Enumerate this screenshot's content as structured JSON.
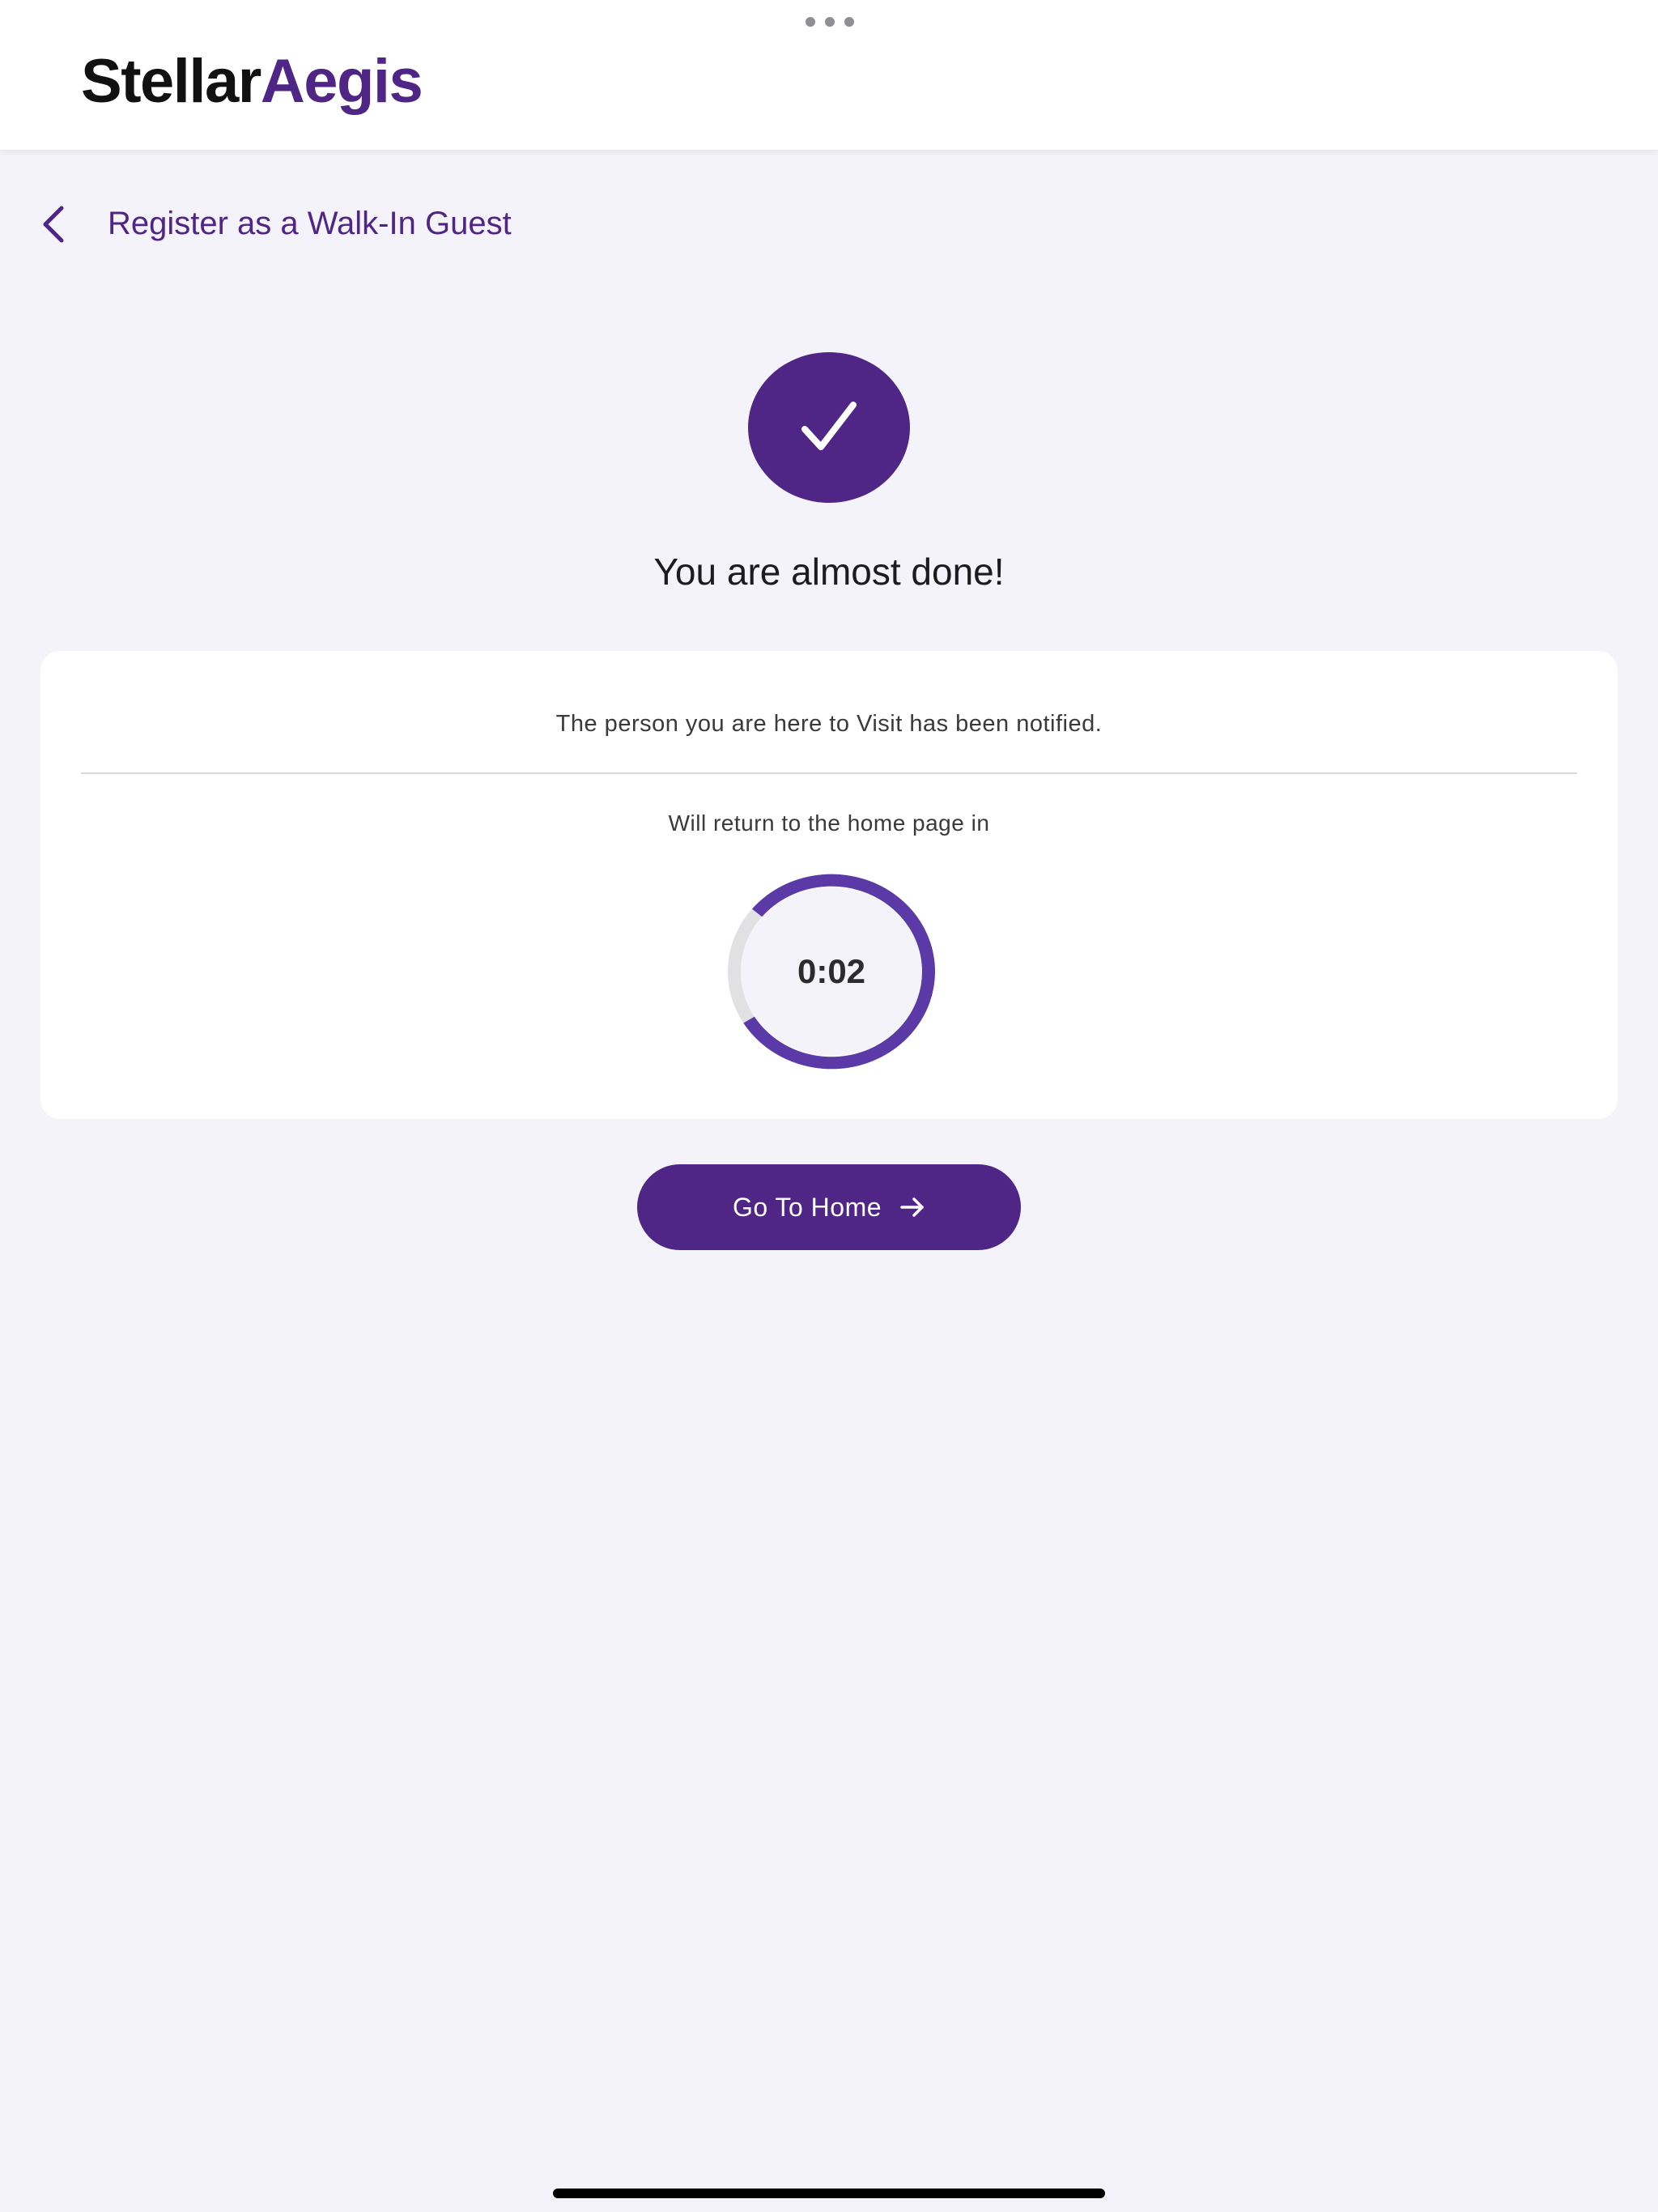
{
  "header": {
    "logo_part1": "Stellar",
    "logo_part2": "Aegis"
  },
  "nav": {
    "back_icon": "chevron-left-icon",
    "title": "Register as a Walk-In Guest"
  },
  "status": {
    "icon": "checkmark-icon",
    "headline": "You are almost done!"
  },
  "card": {
    "message": "The person you are here to Visit has been notified.",
    "return_text": "Will return to the home page in",
    "timer": {
      "value": "0:02",
      "progress_fraction": 0.8
    }
  },
  "actions": {
    "home_label": "Go To Home",
    "home_icon": "arrow-right-icon"
  },
  "colors": {
    "brand": "#4f2586",
    "timer_ring": "#5b3aa8",
    "timer_track": "#e1e1e4",
    "background": "#f4f3f9"
  }
}
